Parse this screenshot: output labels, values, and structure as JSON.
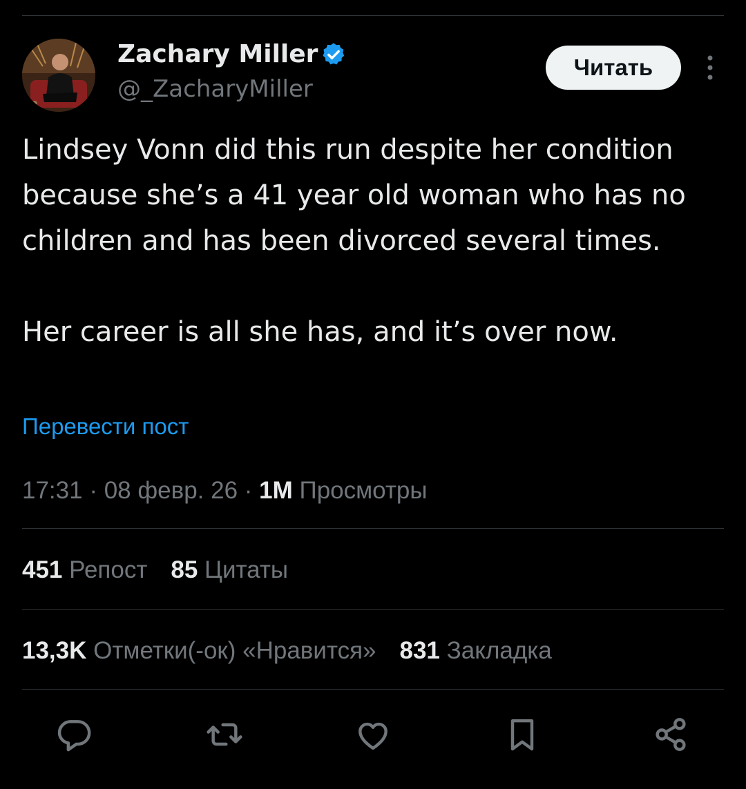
{
  "author": {
    "display_name": "Zachary Miller",
    "handle": "@_ZacharyMiller",
    "verified": true
  },
  "follow_button_label": "Читать",
  "tweet": {
    "paragraphs": [
      "Lindsey Vonn did this run despite her condition because she’s a 41 year old woman who has no children and has been divorced several times.",
      "Her career is all she has, and it’s over now."
    ]
  },
  "translate_label": "Перевести пост",
  "meta": {
    "time": "17:31",
    "separator": " · ",
    "date": "08 февр. 26",
    "views_count": "1M",
    "views_label": "Просмотры"
  },
  "stats": {
    "reposts_count": "451",
    "reposts_label": "Репост",
    "quotes_count": "85",
    "quotes_label": "Цитаты",
    "likes_count": "13,3K",
    "likes_label": "Отметки(-ок) «Нравится»",
    "bookmarks_count": "831",
    "bookmarks_label": "Закладка"
  },
  "actions": [
    "reply-icon",
    "repost-icon",
    "like-icon",
    "bookmark-icon",
    "share-icon"
  ],
  "colors": {
    "background": "#000000",
    "text": "#e7e9ea",
    "secondary": "#71767b",
    "accent": "#1d9bf0",
    "divider": "#2f3336"
  }
}
